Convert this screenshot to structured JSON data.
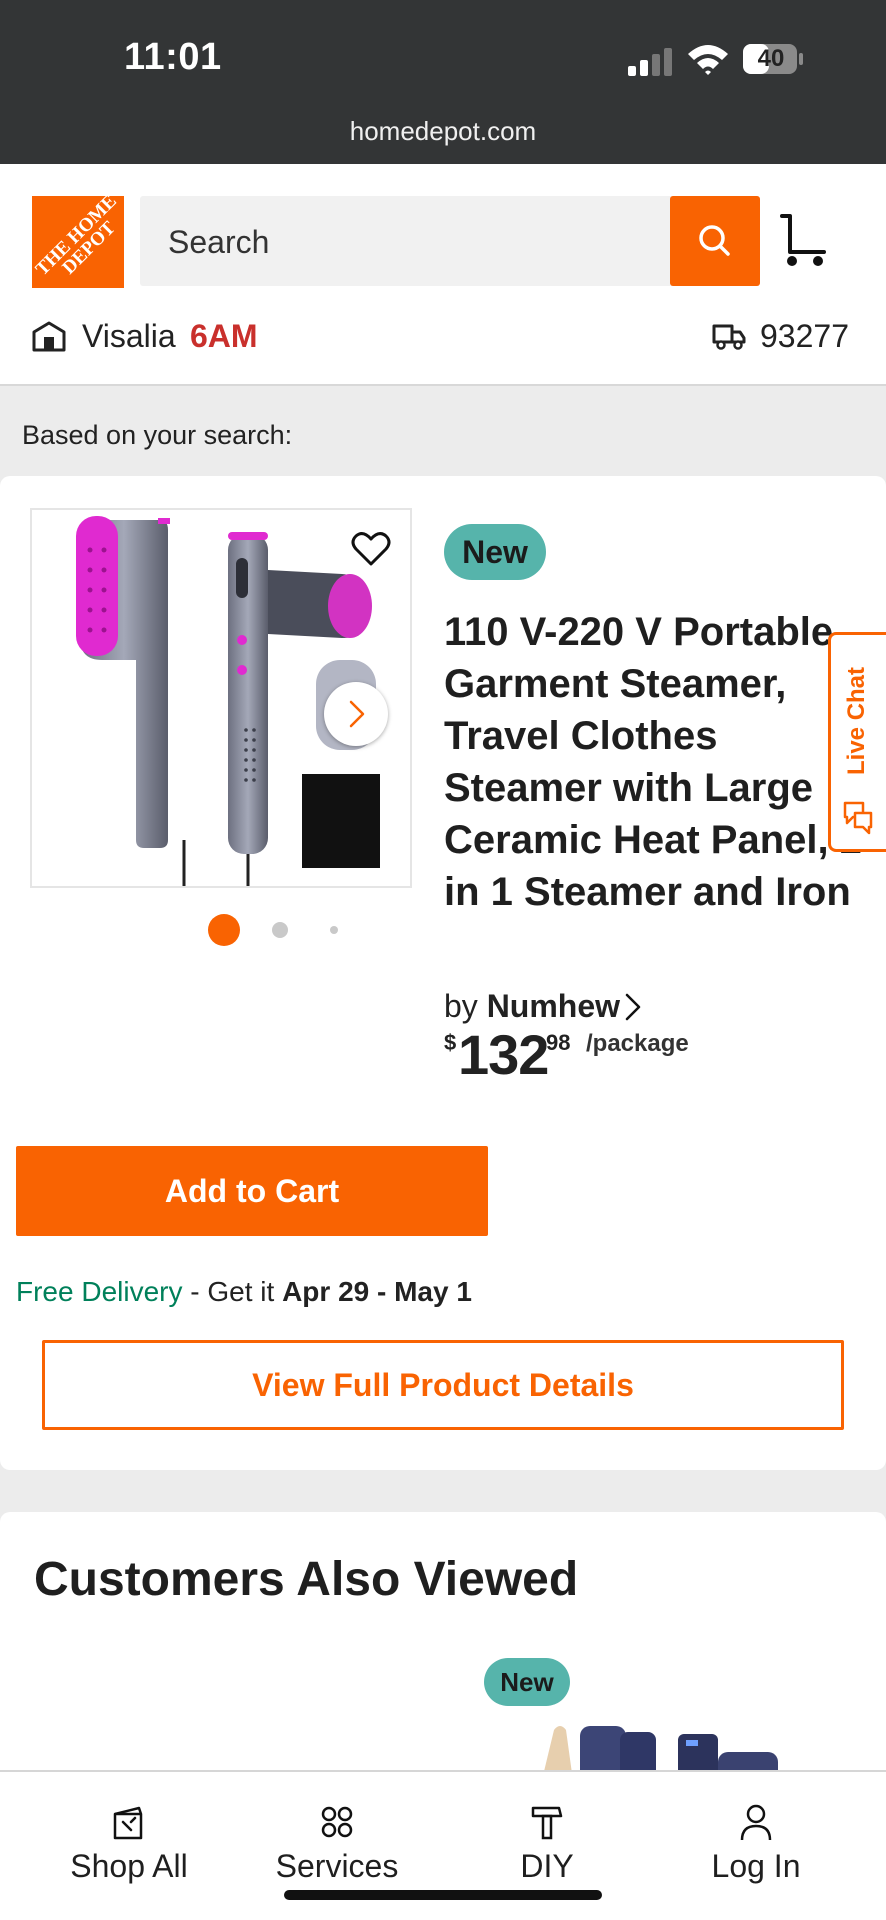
{
  "status_bar": {
    "time": "11:01",
    "battery": "40",
    "url": "homedepot.com"
  },
  "header": {
    "logo_text": "THE HOME DEPOT",
    "search_placeholder": "Search",
    "store_name": "Visalia",
    "store_time": "6AM",
    "zip": "93277"
  },
  "based_on": "Based on your search:",
  "product": {
    "badge": "New",
    "title": "110 V-220 V Portable Garment Steamer, Travel Clothes Steamer with Large Ceramic Heat Panel, 2 in 1 Steamer and Iron",
    "by": "by",
    "brand": "Numhew",
    "price_currency": "$",
    "price_dollars": "132",
    "price_cents": "98",
    "price_unit": "/package",
    "image_dots": {
      "count": 3,
      "active": 0
    },
    "add_to_cart": "Add to Cart",
    "delivery_free": "Free Delivery",
    "delivery_mid": " - Get it ",
    "delivery_dates": "Apr 29 - May 1",
    "view_details": "View Full Product Details"
  },
  "live_chat": "Live Chat",
  "customers_also_viewed": {
    "heading": "Customers Also Viewed",
    "badge": "New"
  },
  "bottom_nav": [
    {
      "label": "Shop All",
      "icon": "shop-all-icon"
    },
    {
      "label": "Services",
      "icon": "services-icon"
    },
    {
      "label": "DIY",
      "icon": "diy-hammer-icon"
    },
    {
      "label": "Log In",
      "icon": "user-icon"
    }
  ],
  "colors": {
    "brand_orange": "#f96302",
    "badge_teal": "#56b4ab",
    "delivery_green": "#00805a",
    "store_time_red": "#c9302c"
  }
}
